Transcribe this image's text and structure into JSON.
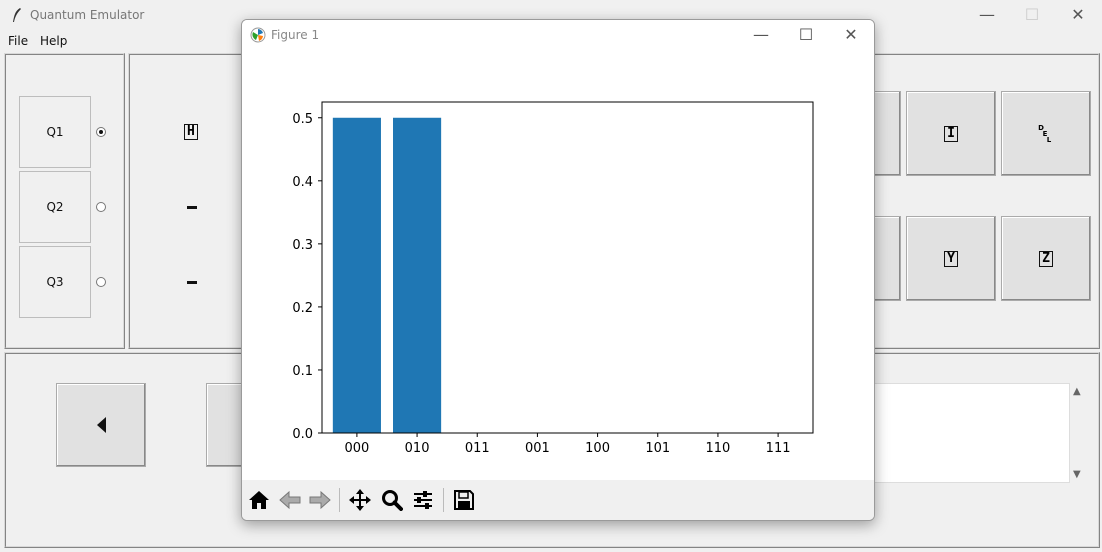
{
  "main_window": {
    "title": "Quantum Emulator",
    "controls": {
      "minimize": "—",
      "maximize": "☐",
      "close": "✕"
    }
  },
  "menu": {
    "items": [
      "File",
      "Help"
    ]
  },
  "qubits": [
    {
      "label": "Q1",
      "selected": true
    },
    {
      "label": "Q2",
      "selected": false
    },
    {
      "label": "Q3",
      "selected": false
    }
  ],
  "circuit": {
    "q1_gate": "H"
  },
  "gates": {
    "i": "I",
    "del_top": "D",
    "del_mid": "E",
    "del_bot": "L",
    "y": "Y",
    "z": "Z"
  },
  "figure_window": {
    "title": "Figure 1",
    "controls": {
      "minimize": "—",
      "maximize": "☐",
      "close": "✕"
    },
    "toolbar": [
      "home-icon",
      "back-arrow-icon",
      "forward-arrow-icon",
      "pan-icon",
      "zoom-icon",
      "configure-subplots-icon",
      "save-icon"
    ]
  },
  "chart_data": {
    "type": "bar",
    "categories": [
      "000",
      "010",
      "011",
      "001",
      "100",
      "101",
      "110",
      "111"
    ],
    "values": [
      0.5,
      0.5,
      0,
      0,
      0,
      0,
      0,
      0
    ],
    "title": "",
    "xlabel": "",
    "ylabel": "",
    "ylim": [
      0,
      0.525
    ],
    "yticks": [
      "0.0",
      "0.1",
      "0.2",
      "0.3",
      "0.4",
      "0.5"
    ],
    "bar_color": "#1f77b4",
    "grid": false
  },
  "colors": {
    "bar": "#1f77b4",
    "window_bg": "#f0f0f0"
  }
}
